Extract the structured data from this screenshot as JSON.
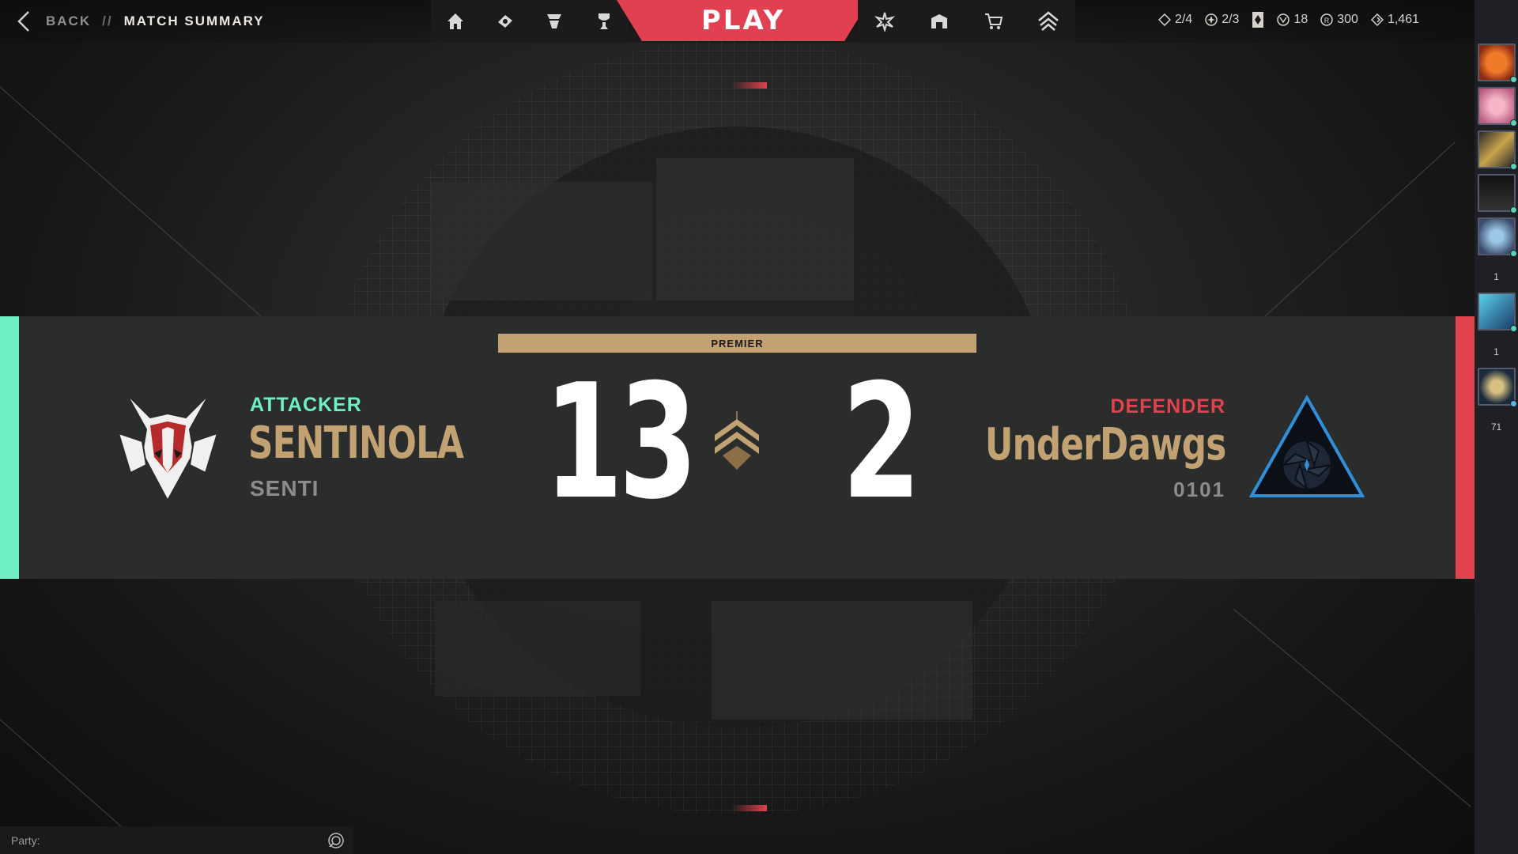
{
  "topbar": {
    "back_label": "BACK",
    "separator": "//",
    "crumb": "MATCH SUMMARY",
    "play_label": "PLAY",
    "nav_left": [
      "home-icon",
      "collection-icon",
      "agents-icon",
      "career-icon"
    ],
    "nav_right": [
      "battlepass-icon",
      "store-icon",
      "cart-icon",
      "premier-icon"
    ]
  },
  "currencies": {
    "radianite_points": "2/4",
    "kingdom_points": "2/3",
    "free_agents": "18",
    "rp": "300",
    "vp": "1,461"
  },
  "rail": {
    "counts": [
      "1",
      "1",
      "71"
    ]
  },
  "match": {
    "mode": "PREMIER",
    "left": {
      "side": "ATTACKER",
      "name": "SENTINOLA",
      "tag": "SENTI",
      "score": "13"
    },
    "right": {
      "side": "DEFENDER",
      "name": "UnderDawgs",
      "tag": "0101",
      "score": "2"
    }
  },
  "party": {
    "label": "Party:"
  },
  "colors": {
    "attacker": "#6fefc3",
    "defender": "#e0424e",
    "gold": "#c2a273",
    "play": "#e0404f"
  }
}
